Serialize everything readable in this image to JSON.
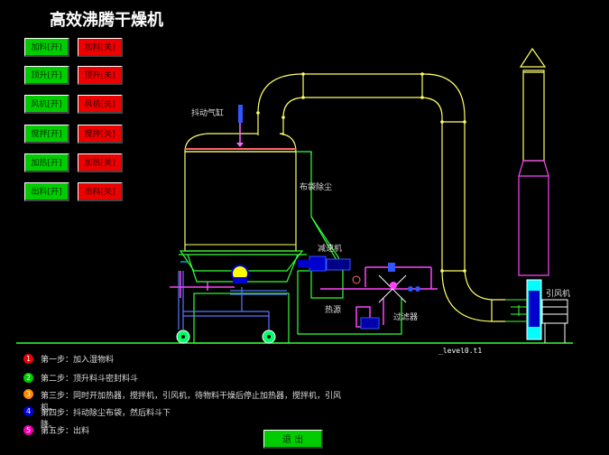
{
  "title": "高效沸腾干燥机",
  "controls": [
    {
      "on": "加料[开]",
      "off": "加料[关]"
    },
    {
      "on": "顶升[开]",
      "off": "顶升[关]"
    },
    {
      "on": "风机[开]",
      "off": "风机[关]"
    },
    {
      "on": "搅拌[开]",
      "off": "搅拌[关]"
    },
    {
      "on": "加热[开]",
      "off": "加热[关]"
    },
    {
      "on": "出料[开]",
      "off": "出料[关]"
    }
  ],
  "labels": {
    "cylinder": "抖动气缸",
    "bag_filter": "布袋除尘",
    "reducer": "减速机",
    "heat_source": "热源",
    "filter": "过滤器",
    "fan": "引风机"
  },
  "steps": [
    {
      "num": "1",
      "text": "第一步：加入湿物料",
      "color": "#e00"
    },
    {
      "num": "2",
      "text": "第二步：顶升料斗密封料斗",
      "color": "#0c0"
    },
    {
      "num": "3",
      "text": "第三步：同时开加热器，搅拌机，引风机，待物料干燥后停止加热器，搅拌机，引风机。",
      "color": "#f80"
    },
    {
      "num": "4",
      "text": "第四步：抖动除尘布袋，然后料斗下降。",
      "color": "#00d"
    },
    {
      "num": "5",
      "text": "第五步：出料",
      "color": "#e0a"
    }
  ],
  "exit_label": "退 出",
  "level_tag": "_level0.t1",
  "colors": {
    "accent_on": "#00cc00",
    "accent_off": "#ee0000",
    "pipe": "#ffff66",
    "frame": "#33ff33"
  }
}
